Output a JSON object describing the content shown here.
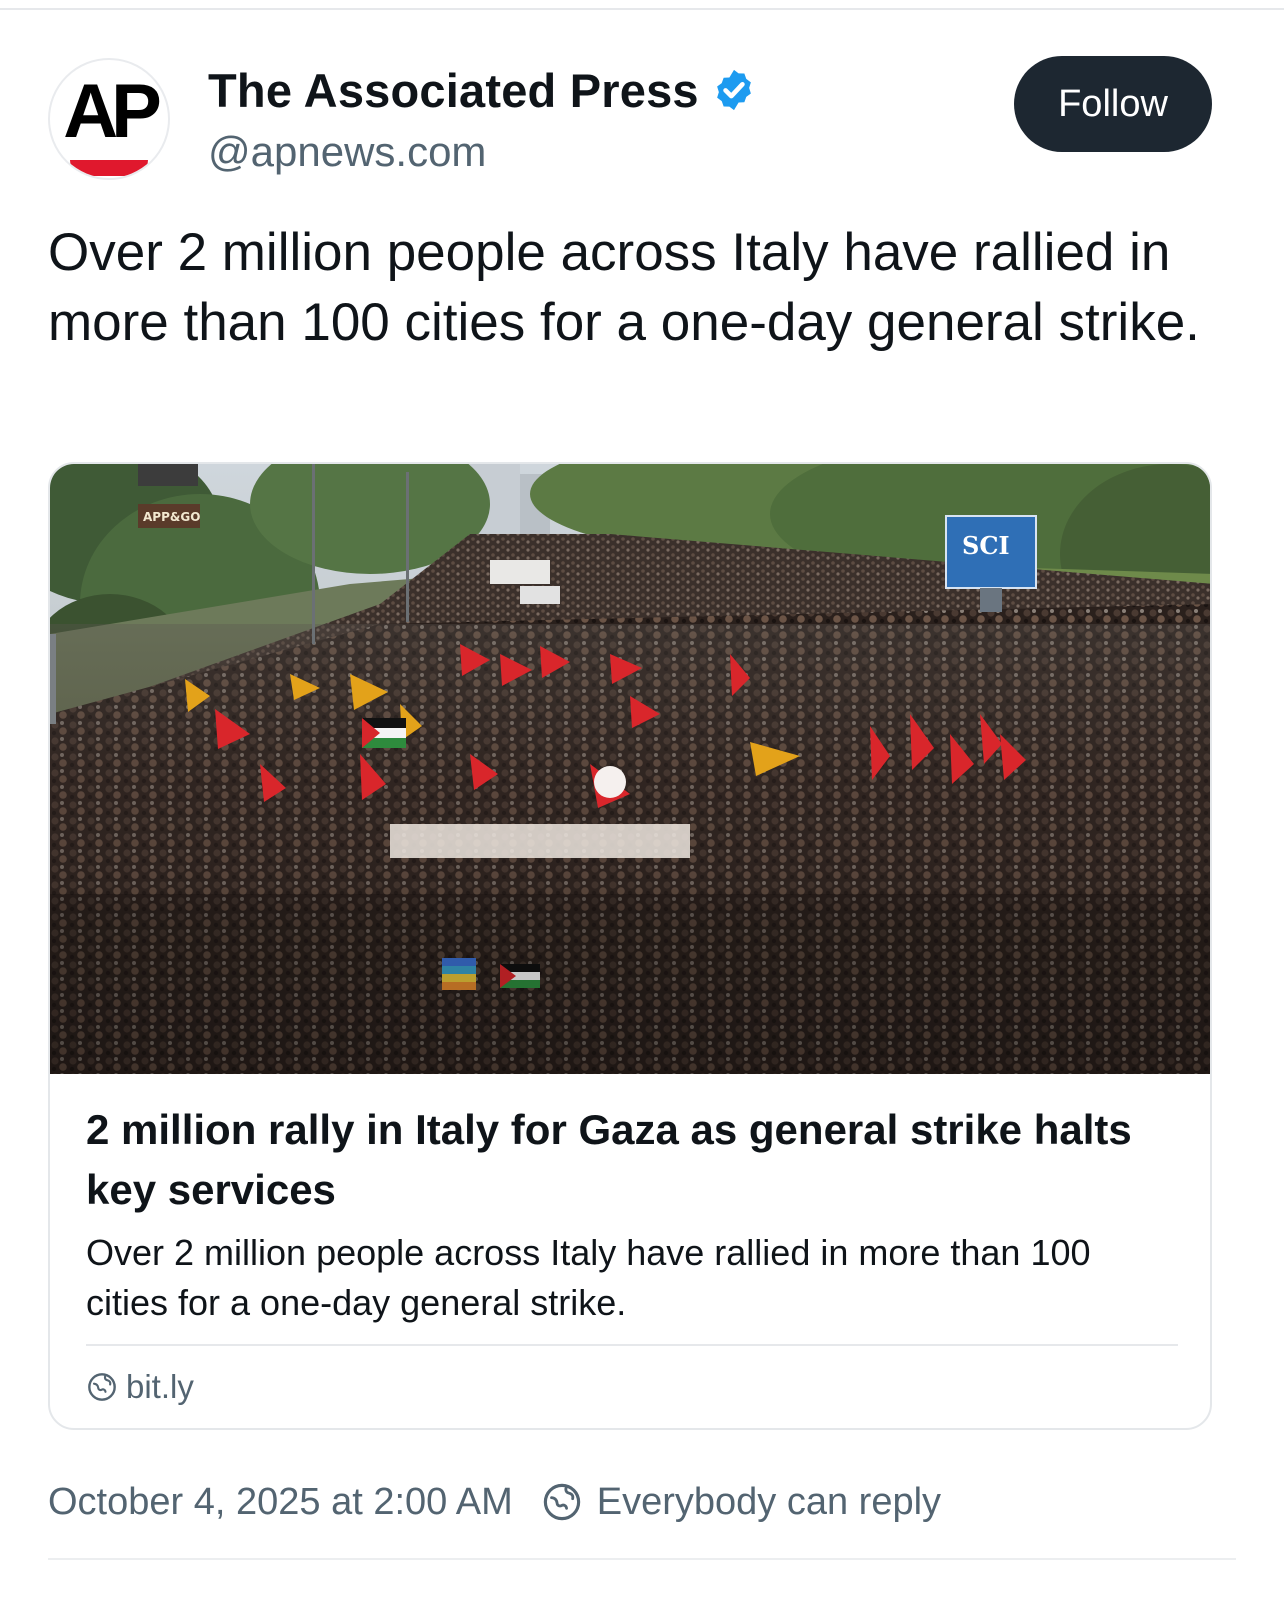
{
  "author": {
    "avatar_text": "AP",
    "display_name": "The Associated Press",
    "handle": "@apnews.com",
    "verified": true,
    "verified_color": "#1d9bf0"
  },
  "follow_label": "Follow",
  "post": {
    "text": "Over 2 million people across Italy have rallied in more than 100 cities for a one-day general strike."
  },
  "link_card": {
    "image_signs": {
      "left_sign": "APP&GO",
      "right_sign": "SCI"
    },
    "headline": "2 million rally in Italy for Gaza as general strike halts key services",
    "description": "Over 2 million people across Italy have rallied in more than 100 cities for a one-day general strike.",
    "source": "bit.ly",
    "source_icon": "globe-icon"
  },
  "footer": {
    "timestamp": "October 4, 2025 at 2:00 AM",
    "reply_setting": "Everybody can reply",
    "reply_icon": "globe-icon"
  },
  "colors": {
    "follow_bg": "#1d2731",
    "muted_text": "#536471",
    "ap_red": "#e0182d"
  }
}
